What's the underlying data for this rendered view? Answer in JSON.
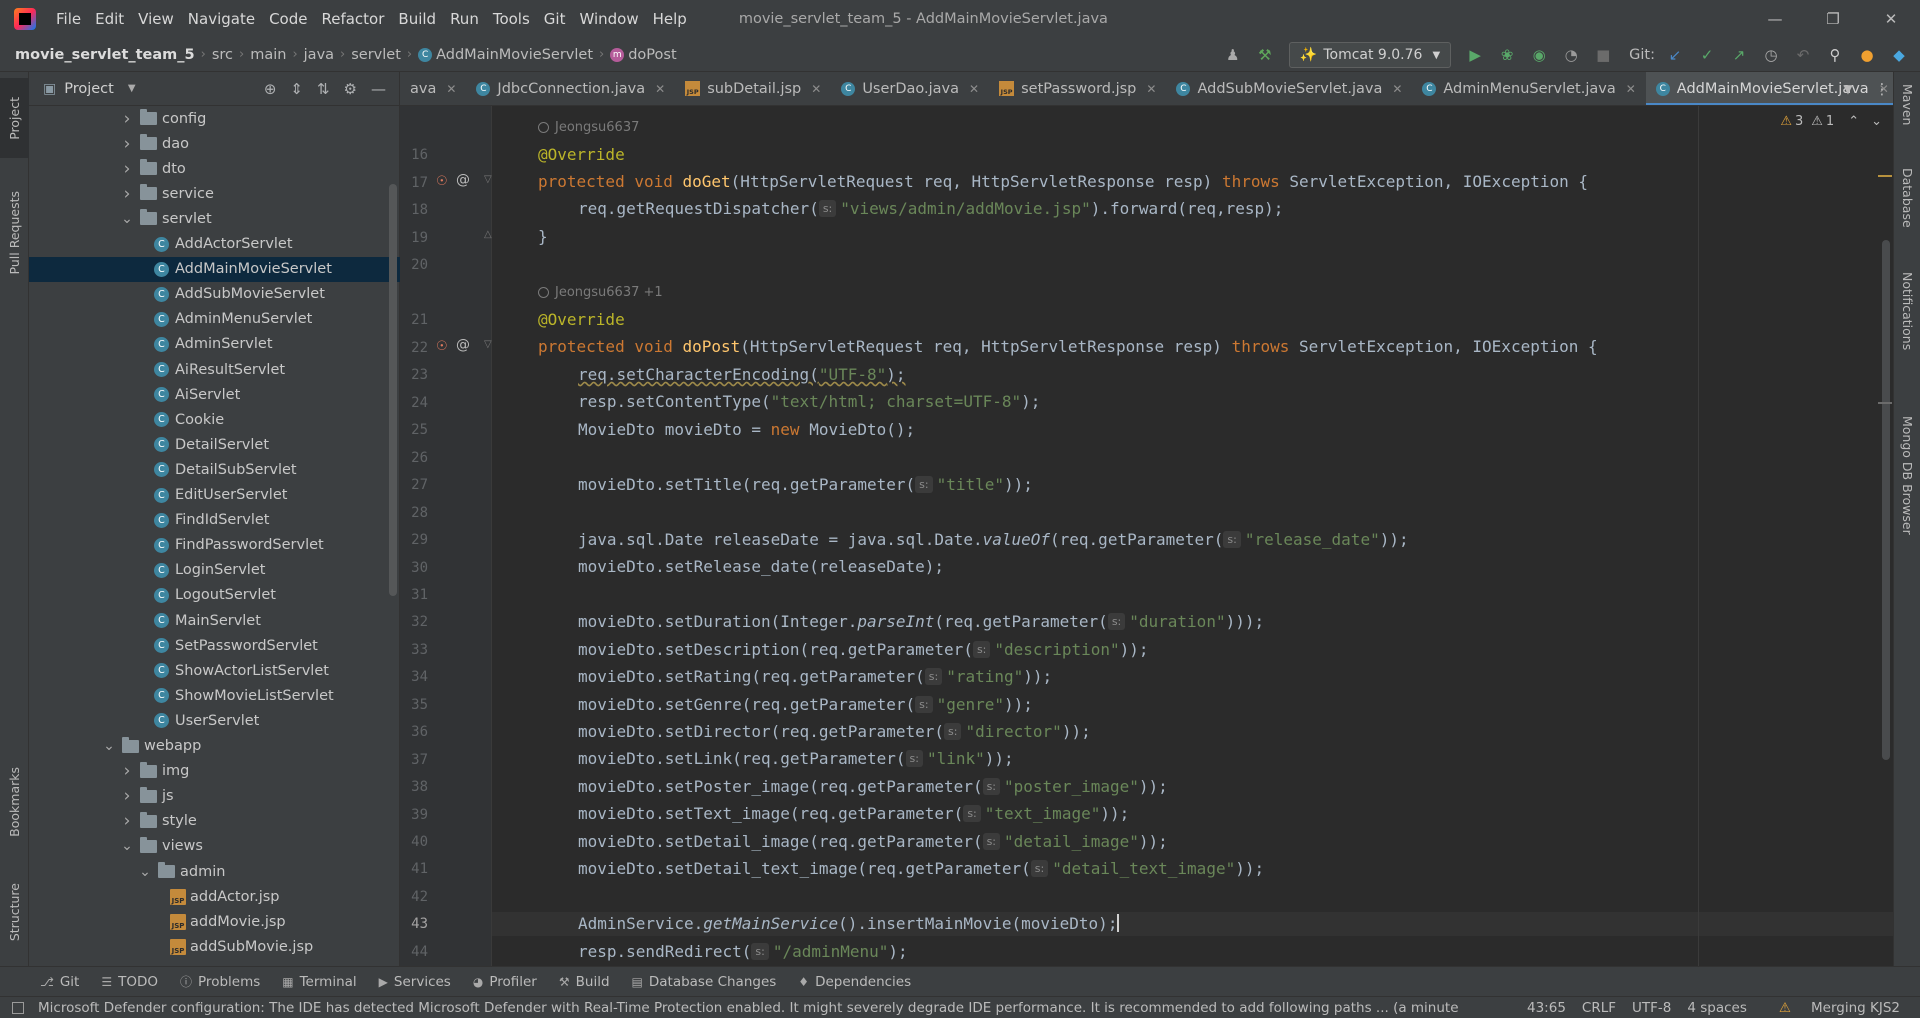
{
  "titlebar": {
    "menu": [
      "File",
      "Edit",
      "View",
      "Navigate",
      "Code",
      "Refactor",
      "Build",
      "Run",
      "Tools",
      "Git",
      "Window",
      "Help"
    ],
    "window_title": "movie_servlet_team_5 - AddMainMovieServlet.java"
  },
  "breadcrumb": [
    "movie_servlet_team_5",
    "src",
    "main",
    "java",
    "servlet",
    "AddMainMovieServlet",
    "doPost"
  ],
  "toolbar": {
    "run_config": "Tomcat 9.0.76",
    "git_label": "Git:"
  },
  "left_strip": [
    "Project",
    "Pull Requests",
    "Bookmarks",
    "Structure"
  ],
  "right_strip": [
    "Maven",
    "Database",
    "Notifications",
    "Mongo DB Browser"
  ],
  "project_panel": {
    "title": "Project",
    "tree": [
      {
        "label": "config",
        "type": "folder",
        "depth": 1,
        "expanded": false
      },
      {
        "label": "dao",
        "type": "folder",
        "depth": 1,
        "expanded": false
      },
      {
        "label": "dto",
        "type": "folder",
        "depth": 1,
        "expanded": false
      },
      {
        "label": "service",
        "type": "folder",
        "depth": 1,
        "expanded": false
      },
      {
        "label": "servlet",
        "type": "folder",
        "depth": 1,
        "expanded": true
      },
      {
        "label": "AddActorServlet",
        "type": "class",
        "depth": 2
      },
      {
        "label": "AddMainMovieServlet",
        "type": "class",
        "depth": 2,
        "selected": true
      },
      {
        "label": "AddSubMovieServlet",
        "type": "class",
        "depth": 2
      },
      {
        "label": "AdminMenuServlet",
        "type": "class",
        "depth": 2
      },
      {
        "label": "AdminServlet",
        "type": "class",
        "depth": 2
      },
      {
        "label": "AiResultServlet",
        "type": "class",
        "depth": 2
      },
      {
        "label": "AiServlet",
        "type": "class",
        "depth": 2
      },
      {
        "label": "Cookie",
        "type": "class",
        "depth": 2
      },
      {
        "label": "DetailServlet",
        "type": "class",
        "depth": 2
      },
      {
        "label": "DetailSubServlet",
        "type": "class",
        "depth": 2
      },
      {
        "label": "EditUserServlet",
        "type": "class",
        "depth": 2
      },
      {
        "label": "FindIdServlet",
        "type": "class",
        "depth": 2
      },
      {
        "label": "FindPasswordServlet",
        "type": "class",
        "depth": 2
      },
      {
        "label": "LoginServlet",
        "type": "class",
        "depth": 2
      },
      {
        "label": "LogoutServlet",
        "type": "class",
        "depth": 2
      },
      {
        "label": "MainServlet",
        "type": "class",
        "depth": 2
      },
      {
        "label": "SetPasswordServlet",
        "type": "class",
        "depth": 2
      },
      {
        "label": "ShowActorListServlet",
        "type": "class",
        "depth": 2
      },
      {
        "label": "ShowMovieListServlet",
        "type": "class",
        "depth": 2
      },
      {
        "label": "UserServlet",
        "type": "class",
        "depth": 2
      },
      {
        "label": "webapp",
        "type": "folder",
        "depth": 0,
        "expanded": true
      },
      {
        "label": "img",
        "type": "folder",
        "depth": 1,
        "expanded": false
      },
      {
        "label": "js",
        "type": "folder",
        "depth": 1,
        "expanded": false
      },
      {
        "label": "style",
        "type": "folder",
        "depth": 1,
        "expanded": false
      },
      {
        "label": "views",
        "type": "folder",
        "depth": 1,
        "expanded": true
      },
      {
        "label": "admin",
        "type": "folder",
        "depth": 2,
        "expanded": true
      },
      {
        "label": "addActor.jsp",
        "type": "jsp",
        "depth": 3
      },
      {
        "label": "addMovie.jsp",
        "type": "jsp",
        "depth": 3
      },
      {
        "label": "addSubMovie.jsp",
        "type": "jsp",
        "depth": 3
      }
    ]
  },
  "editor_tabs": [
    {
      "label": "ava",
      "icon": "none"
    },
    {
      "label": "JdbcConnection.java",
      "icon": "class"
    },
    {
      "label": "subDetail.jsp",
      "icon": "jsp"
    },
    {
      "label": "UserDao.java",
      "icon": "class"
    },
    {
      "label": "setPassword.jsp",
      "icon": "jsp"
    },
    {
      "label": "AddSubMovieServlet.java",
      "icon": "class"
    },
    {
      "label": "AdminMenuServlet.java",
      "icon": "class"
    },
    {
      "label": "AddMainMovieServlet.java",
      "icon": "class",
      "active": true
    }
  ],
  "inspections": {
    "warnings": "3",
    "errors": "1"
  },
  "authors": {
    "first": "Jeongsu6637",
    "second": "Jeongsu6637 +1"
  },
  "line_numbers": [
    "16",
    "17",
    "18",
    "19",
    "20",
    "21",
    "22",
    "23",
    "24",
    "25",
    "26",
    "27",
    "28",
    "29",
    "30",
    "31",
    "32",
    "33",
    "34",
    "35",
    "36",
    "37",
    "38",
    "39",
    "40",
    "41",
    "42",
    "43",
    "44"
  ],
  "code": {
    "l16": "@Override",
    "l17_kw": "protected void ",
    "l17_fn": "doGet",
    "l17_a": "(HttpServletRequest req, HttpServletResponse resp) ",
    "l17_kw2": "throws ",
    "l17_b": "ServletException, IOException {",
    "l18_a": "req.getRequestDispatcher(",
    "l18_s": "\"views/admin/addMovie.jsp\"",
    "l18_b": ").forward(req,resp);",
    "l19": "}",
    "l21": "@Override",
    "l22_kw": "protected void ",
    "l22_fn": "doPost",
    "l22_a": "(HttpServletRequest req, HttpServletResponse resp) ",
    "l22_kw2": "throws ",
    "l22_b": "ServletException, IOException {",
    "l23_a": "req.setCharacterEncoding(",
    "l23_s": "\"UTF-8\"",
    "l23_b": ");",
    "l24_a": "resp.setContentType(",
    "l24_s": "\"text/html; charset=UTF-8\"",
    "l24_b": ");",
    "l25_a": "MovieDto movieDto = ",
    "l25_kw": "new ",
    "l25_b": "MovieDto();",
    "l27_a": "movieDto.setTitle(req.getParameter(",
    "l27_s": "\"title\"",
    "l27_b": "));",
    "l29_a": "java.sql.Date releaseDate = java.sql.Date.",
    "l29_it": "valueOf",
    "l29_b": "(req.getParameter(",
    "l29_s": "\"release_date\"",
    "l29_c": "));",
    "l30": "movieDto.setRelease_date(releaseDate);",
    "l32_a": "movieDto.setDuration(Integer.",
    "l32_it": "parseInt",
    "l32_b": "(req.getParameter(",
    "l32_s": "\"duration\"",
    "l32_c": ")));",
    "l33_a": "movieDto.setDescription(req.getParameter(",
    "l33_s": "\"description\"",
    "l33_b": "));",
    "l34_a": "movieDto.setRating(req.getParameter(",
    "l34_s": "\"rating\"",
    "l34_b": "));",
    "l35_a": "movieDto.setGenre(req.getParameter(",
    "l35_s": "\"genre\"",
    "l35_b": "));",
    "l36_a": "movieDto.setDirector(req.getParameter(",
    "l36_s": "\"director\"",
    "l36_b": "));",
    "l37_a": "movieDto.setLink(req.getParameter(",
    "l37_s": "\"link\"",
    "l37_b": "));",
    "l38_a": "movieDto.setPoster_image(req.getParameter(",
    "l38_s": "\"poster_image\"",
    "l38_b": "));",
    "l39_a": "movieDto.setText_image(req.getParameter(",
    "l39_s": "\"text_image\"",
    "l39_b": "));",
    "l40_a": "movieDto.setDetail_image(req.getParameter(",
    "l40_s": "\"detail_image\"",
    "l40_b": "));",
    "l41_a": "movieDto.setDetail_text_image(req.getParameter(",
    "l41_s": "\"detail_text_image\"",
    "l41_b": "));",
    "l43_a": "AdminService.",
    "l43_it": "getMainService",
    "l43_b": "().insertMainMovie(movieDto);",
    "l44_a": "resp.sendRedirect(",
    "l44_s": "\"/adminMenu\"",
    "l44_b": ");",
    "hint": "s:"
  },
  "bottom_tools": [
    "Git",
    "TODO",
    "Problems",
    "Terminal",
    "Services",
    "Profiler",
    "Build",
    "Database Changes",
    "Dependencies"
  ],
  "status": {
    "message": "Microsoft Defender configuration: The IDE has detected Microsoft Defender with Real-Time Protection enabled. It might severely degrade IDE performance. It is recommended to add following paths ... (a minute",
    "position": "43:65",
    "line_sep": "CRLF",
    "encoding": "UTF-8",
    "indent": "4 spaces",
    "branch": "Merging KJS2"
  }
}
